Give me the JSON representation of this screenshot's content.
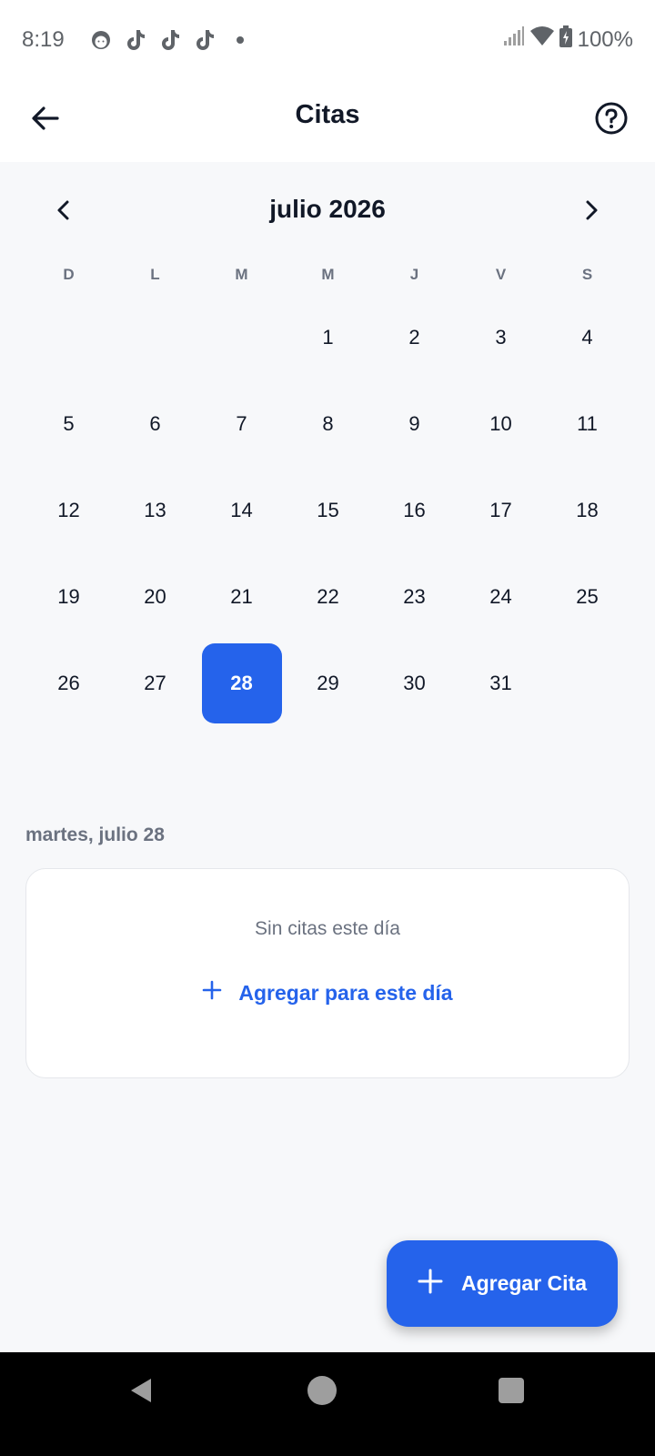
{
  "status_bar": {
    "time": "8:19",
    "battery": "100%",
    "notification_icons": [
      "face-icon",
      "tiktok-icon",
      "tiktok-icon",
      "tiktok-icon"
    ]
  },
  "app_bar": {
    "title": "Citas",
    "back_icon": "arrow-back-icon",
    "help_icon": "help-circle-icon"
  },
  "calendar": {
    "month_label": "julio 2026",
    "weekdays": [
      "D",
      "L",
      "M",
      "M",
      "J",
      "V",
      "S"
    ],
    "leading_blanks": 3,
    "days": [
      "1",
      "2",
      "3",
      "4",
      "5",
      "6",
      "7",
      "8",
      "9",
      "10",
      "11",
      "12",
      "13",
      "14",
      "15",
      "16",
      "17",
      "18",
      "19",
      "20",
      "21",
      "22",
      "23",
      "24",
      "25",
      "26",
      "27",
      "28",
      "29",
      "30",
      "31"
    ],
    "selected_day": "28"
  },
  "selected_date_label": "martes, julio 28",
  "events": {
    "empty_text": "Sin citas este día",
    "add_for_day_label": "Agregar para este día"
  },
  "fab": {
    "label": "Agregar Cita"
  },
  "colors": {
    "accent": "#2563eb",
    "background": "#f7f8fa",
    "text_primary": "#111827",
    "text_secondary": "#6b7280"
  }
}
